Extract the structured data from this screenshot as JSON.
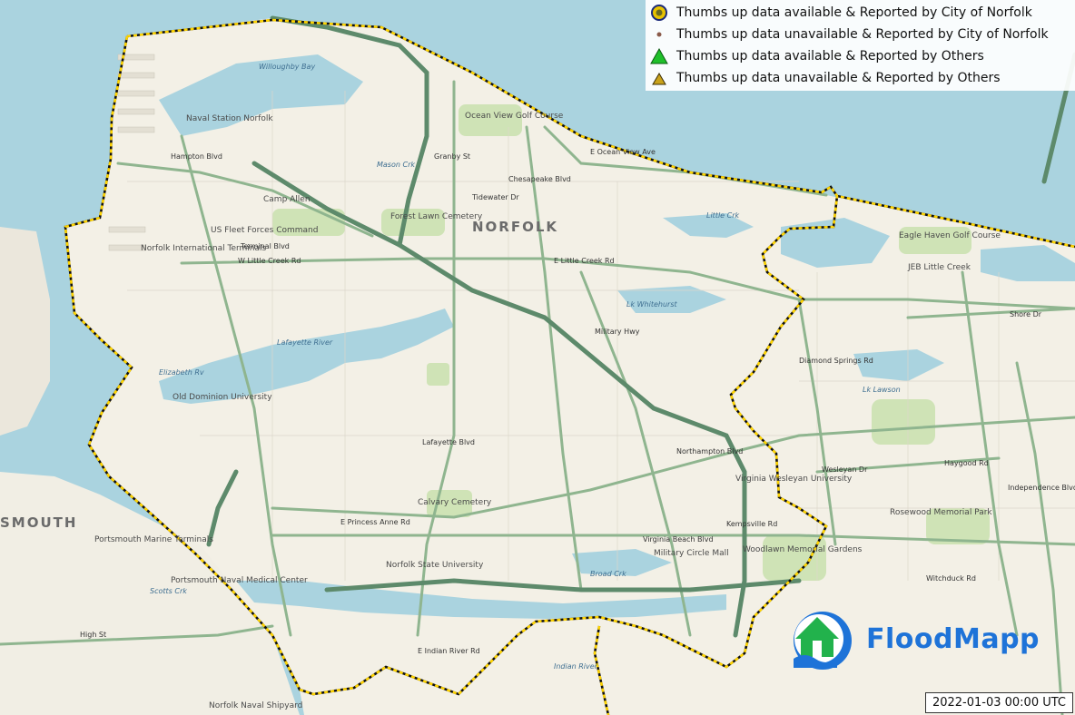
{
  "legend": {
    "items": [
      {
        "label": "Thumbs up data available & Reported by City of Norfolk",
        "icon": "circle-yellow-icon"
      },
      {
        "label": "Thumbs up data unavailable & Reported by City of Norfolk",
        "icon": "dot-brown-icon"
      },
      {
        "label": "Thumbs up data available & Reported by Others",
        "icon": "triangle-green-icon"
      },
      {
        "label": "Thumbs up data unavailable & Reported by Others",
        "icon": "triangle-olive-icon"
      }
    ]
  },
  "timestamp": "2022-01-03 00:00 UTC",
  "logo": {
    "text": "FloodMapp"
  },
  "map": {
    "city": "NORFOLK",
    "city_partial": "SMOUTH",
    "places": [
      "Naval Station Norfolk",
      "Camp Allen",
      "US Fleet Forces Command",
      "Norfolk International Terminals",
      "Forest Lawn Cemetery",
      "Ocean View Golf Course",
      "JEB Little Creek",
      "Old Dominion University",
      "Virginia Wesleyan University",
      "Norfolk State University",
      "Military Circle Mall",
      "Woodlawn Memorial Gardens",
      "Rosewood Memorial Park",
      "Portsmouth Marine Terminals",
      "Portsmouth Naval Medical Center",
      "Calvary Cemetery",
      "Eagle Haven Golf Course",
      "Norfolk Naval Shipyard",
      "Willoughby Bay",
      "Mason Crk",
      "Lafayette River",
      "Elizabeth Rv",
      "Lk Whitehurst",
      "Lk Lawson",
      "Little Crk",
      "Broad Crk",
      "Indian River",
      "Scotts Crk",
      "E Little Creek Rd",
      "W Little Creek Rd",
      "Terminal Blvd",
      "E Princess Anne Rd",
      "Northampton Blvd",
      "Virginia Beach Blvd",
      "E Ocean View Ave",
      "Lafayette Blvd",
      "High St",
      "Shore Dr",
      "Haygood Rd",
      "Wesleyan Dr",
      "Military Hwy",
      "Granby St",
      "Hampton Blvd",
      "Chesapeake Blvd",
      "Tidewater Dr",
      "E Indian River Rd",
      "Kempsville Rd",
      "Witchduck Rd",
      "Independence Blvd",
      "Diamond Springs Rd"
    ]
  },
  "colors": {
    "water": "#aad3df",
    "land": "#f4f1e8",
    "green": "#c8dfae",
    "highway": "#6f9b78",
    "boundary": "#ffd400"
  }
}
